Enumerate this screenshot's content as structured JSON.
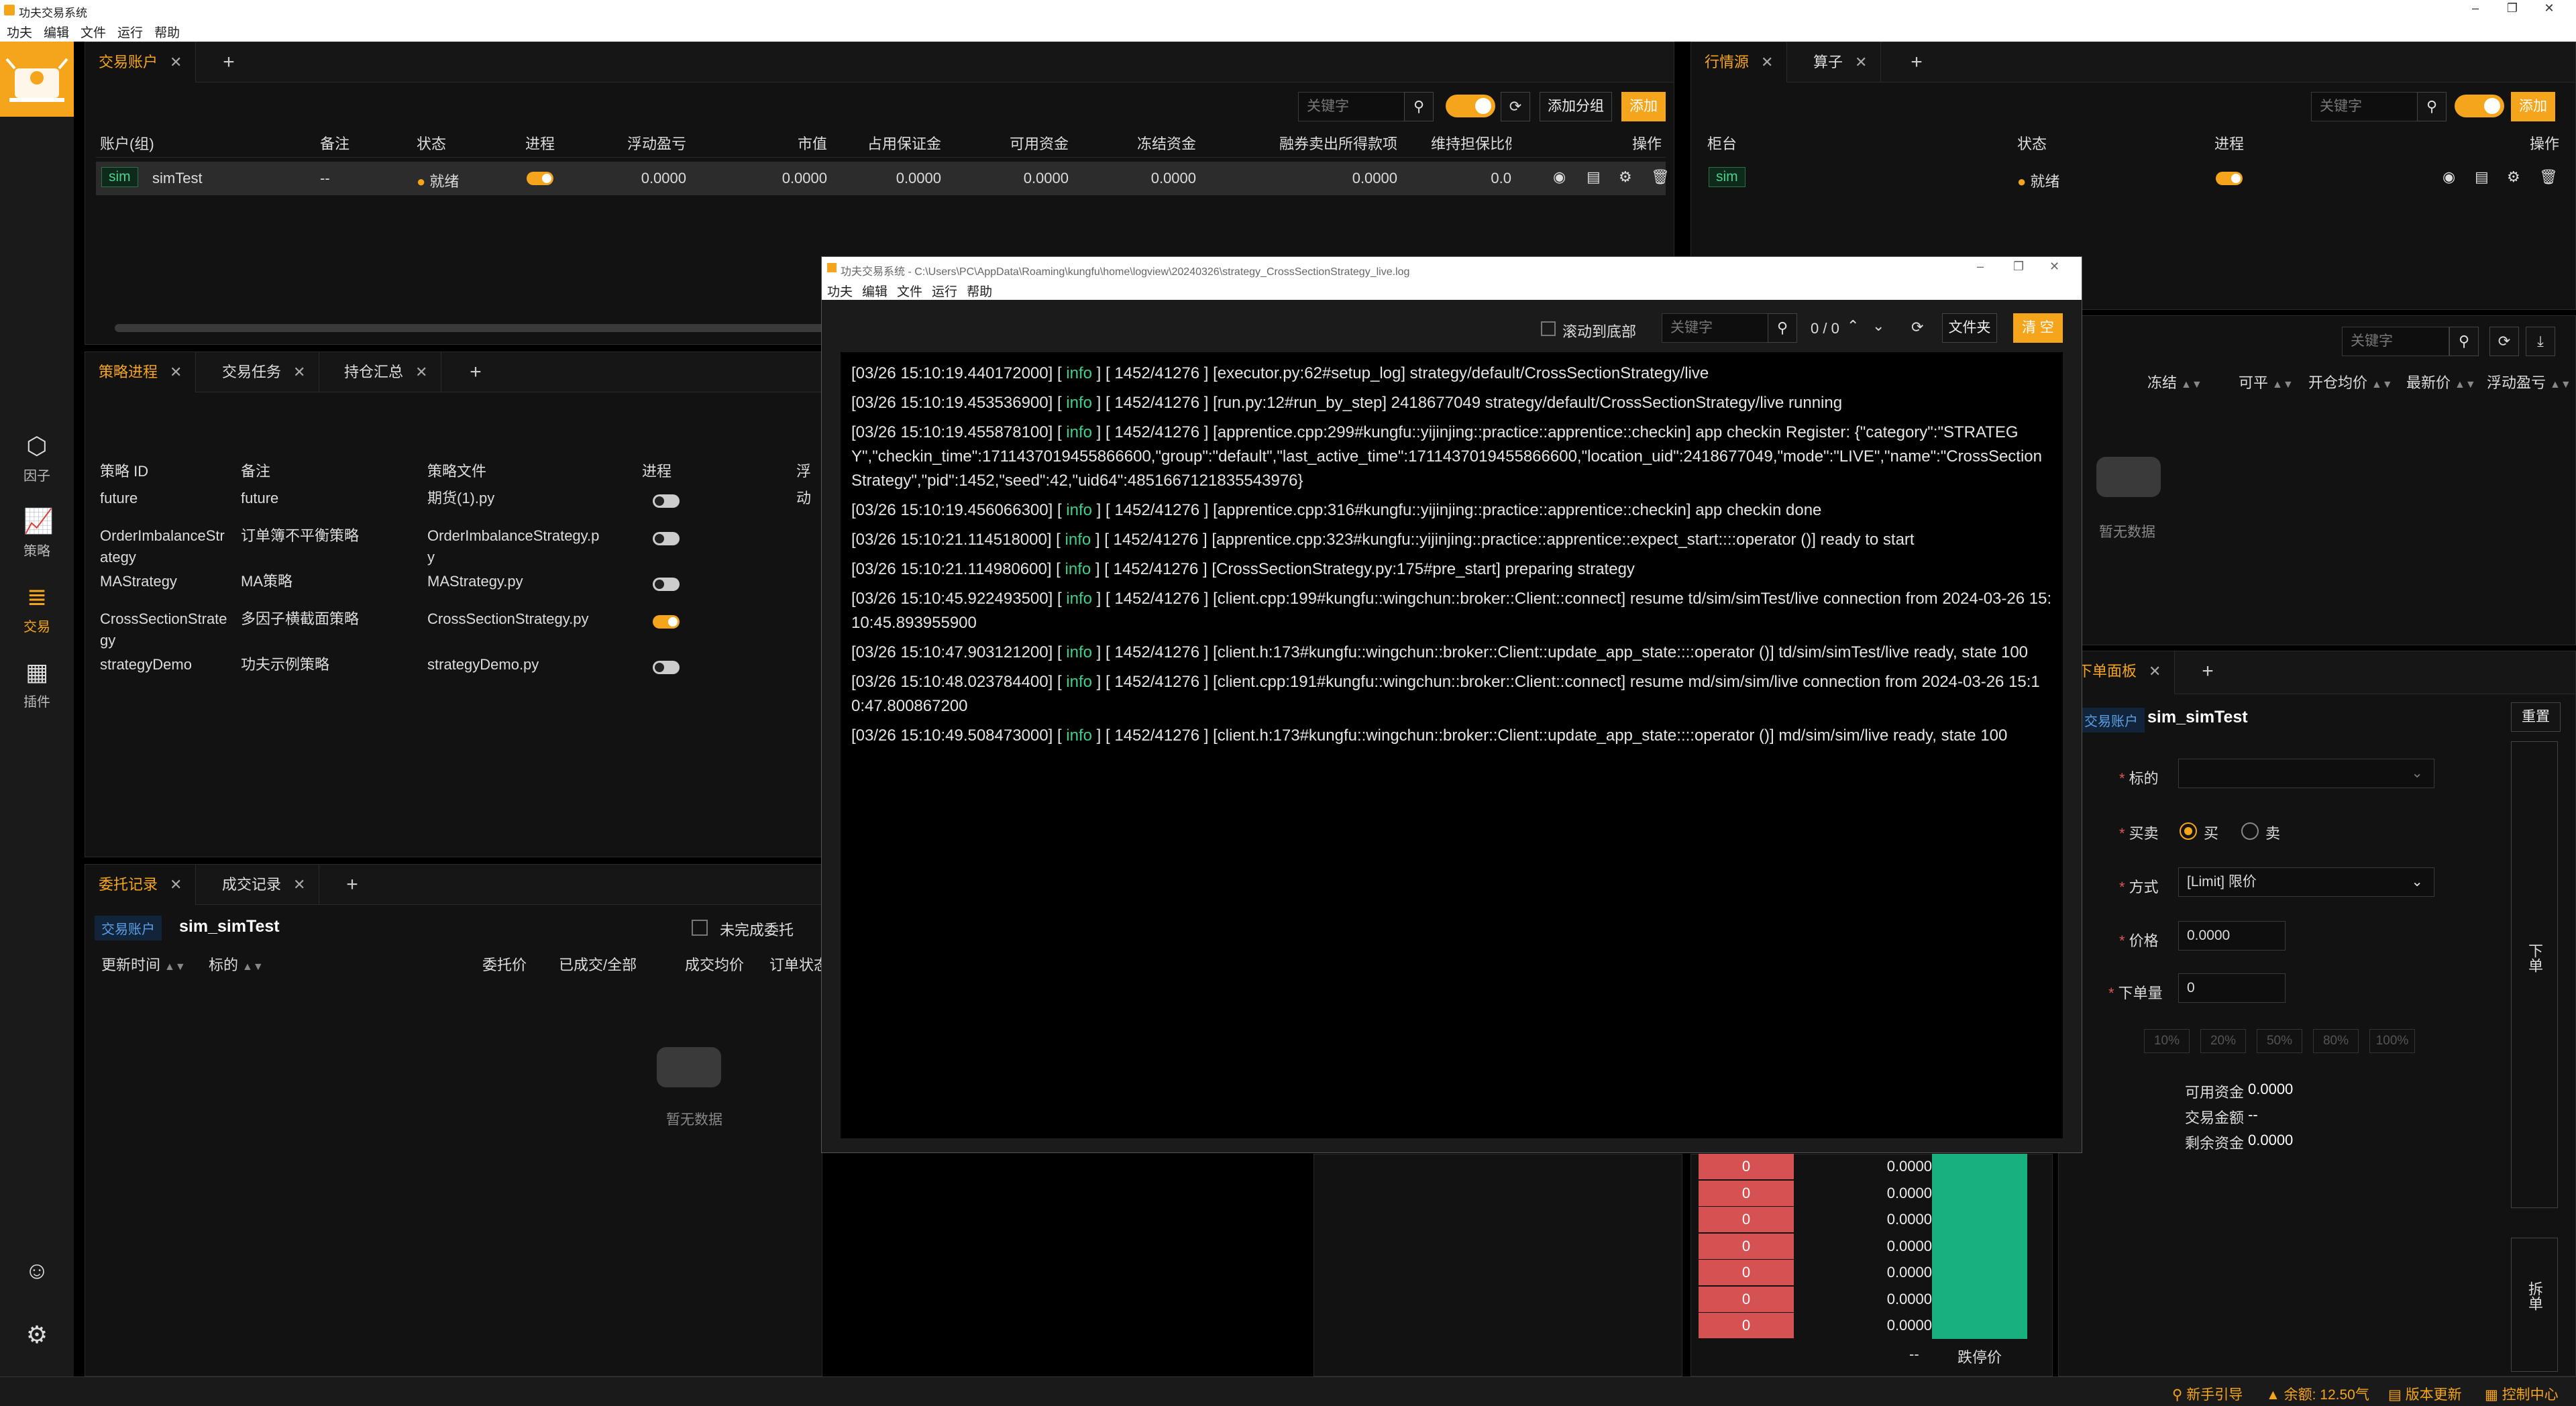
{
  "app": {
    "title": "功夫交易系统"
  },
  "menu": [
    "功夫",
    "编辑",
    "文件",
    "运行",
    "帮助"
  ],
  "sidebar": {
    "items": [
      {
        "label": "因子",
        "icon": "cube-icon"
      },
      {
        "label": "策略",
        "icon": "chart-line-icon"
      },
      {
        "label": "交易",
        "icon": "trade-icon",
        "active": true
      },
      {
        "label": "插件",
        "icon": "plugin-icon"
      }
    ]
  },
  "accounts": {
    "tab": "交易账户",
    "search_placeholder": "关键字",
    "add_group": "添加分组",
    "add": "添加",
    "columns": [
      "账户(组)",
      "备注",
      "状态",
      "进程",
      "浮动盈亏",
      "市值",
      "占用保证金",
      "可用资金",
      "冻结资金",
      "融券卖出所得款项",
      "维持担保比例",
      "操作"
    ],
    "rows": [
      {
        "tag": "sim",
        "name": "simTest",
        "note": "--",
        "status": "就绪",
        "floating": "0.0000",
        "market": "0.0000",
        "margin": "0.0000",
        "available": "0.0000",
        "frozen": "0.0000",
        "short_proceeds": "0.0000",
        "ratio": "0.0",
        "process_on": true
      }
    ]
  },
  "market": {
    "tabs": [
      "行情源",
      "算子"
    ],
    "search_placeholder": "关键字",
    "add": "添加",
    "columns": [
      "柜台",
      "状态",
      "进程",
      "操作"
    ],
    "rows": [
      {
        "tag": "sim",
        "status": "就绪",
        "process_on": true
      }
    ]
  },
  "positions": {
    "search_placeholder": "关键字",
    "columns": [
      "冻结",
      "可平",
      "开仓均价",
      "最新价",
      "浮动盈亏"
    ],
    "empty": "暂无数据"
  },
  "strategies": {
    "tabs": [
      "策略进程",
      "交易任务",
      "持仓汇总"
    ],
    "columns": [
      "策略 ID",
      "备注",
      "策略文件",
      "进程",
      "浮动"
    ],
    "rows": [
      {
        "id": "future",
        "note": "future",
        "file": "期货(1).py",
        "on": false
      },
      {
        "id": "OrderImbalanceStr\nategy",
        "note": "订单簿不平衡策略",
        "file": "OrderImbalanceStrategy.p\ny",
        "on": false
      },
      {
        "id": "MAStrategy",
        "note": "MA策略",
        "file": "MAStrategy.py",
        "on": false
      },
      {
        "id": "CrossSectionStrate\ngy",
        "note": "多因子横截面策略",
        "file": "CrossSectionStrategy.py",
        "on": true
      },
      {
        "id": "strategyDemo",
        "note": "功夫示例策略",
        "file": "strategyDemo.py",
        "on": false
      }
    ]
  },
  "orders": {
    "tabs": [
      "委托记录",
      "成交记录"
    ],
    "account_tag": "交易账户",
    "account_name": "sim_simTest",
    "unfinished": "未完成委托",
    "columns": [
      "更新时间",
      "标的",
      "委托价",
      "已成交/全部",
      "成交均价",
      "订单状态"
    ],
    "empty": "暂无数据"
  },
  "depth": {
    "bid_values": [
      "0",
      "0",
      "0",
      "0",
      "0",
      "0",
      "0"
    ],
    "prices": [
      "0.0000",
      "0.0000",
      "0.0000",
      "0.0000",
      "0.0000",
      "0.0000",
      "0.0000"
    ],
    "dash": "--",
    "limit_down": "跌停价"
  },
  "order_panel": {
    "tab": "下单面板",
    "account_tag": "交易账户",
    "account_name": "sim_simTest",
    "reset": "重置",
    "labels": {
      "instrument": "标的",
      "side": "买卖",
      "method": "方式",
      "price": "价格",
      "volume": "下单量"
    },
    "buy": "买",
    "sell": "卖",
    "method_value": "[Limit] 限价",
    "price_value": "0.0000",
    "volume_value": "0",
    "percents": [
      "10%",
      "20%",
      "50%",
      "80%",
      "100%"
    ],
    "available_label": "可用资金",
    "available_value": "0.0000",
    "amount_label": "交易金额",
    "amount_value": "--",
    "remain_label": "剩余资金",
    "remain_value": "0.0000",
    "submit": "下单",
    "split": "拆单"
  },
  "logwindow": {
    "title": "功夫交易系统 - C:\\Users\\PC\\AppData\\Roaming\\kungfu\\home\\logview\\20240326\\strategy_CrossSectionStrategy_live.log",
    "menu": [
      "功夫",
      "编辑",
      "文件",
      "运行",
      "帮助"
    ],
    "scroll_bottom": "滚动到底部",
    "search_placeholder": "关键字",
    "count": "0 / 0",
    "folder": "文件夹",
    "clear": "清 空",
    "lines": [
      {
        "pre": "[03/26 15:10:19.440172000] [ ",
        "lvl": "info",
        "post": " ] [ 1452/41276 ] [executor.py:62#setup_log] strategy/default/CrossSectionStrategy/live"
      },
      {
        "pre": "[03/26 15:10:19.453536900] [ ",
        "lvl": "info",
        "post": " ] [ 1452/41276 ] [run.py:12#run_by_step] 2418677049 strategy/default/CrossSectionStrategy/live running"
      },
      {
        "pre": "[03/26 15:10:19.455878100] [ ",
        "lvl": "info",
        "post": " ] [ 1452/41276 ] [apprentice.cpp:299#kungfu::yijinjing::practice::apprentice::checkin] app checkin Register: {\"category\":\"STRATEGY\",\"checkin_time\":1711437019455866600,\"group\":\"default\",\"last_active_time\":1711437019455866600,\"location_uid\":2418677049,\"mode\":\"LIVE\",\"name\":\"CrossSectionStrategy\",\"pid\":1452,\"seed\":42,\"uid64\":4851667121835543976}"
      },
      {
        "pre": "[03/26 15:10:19.456066300] [ ",
        "lvl": "info",
        "post": " ] [ 1452/41276 ] [apprentice.cpp:316#kungfu::yijinjing::practice::apprentice::checkin] app checkin done"
      },
      {
        "pre": "[03/26 15:10:21.114518000] [ ",
        "lvl": "info",
        "post": " ] [ 1452/41276 ] [apprentice.cpp:323#kungfu::yijinjing::practice::apprentice::expect_start::::operator ()] ready to start"
      },
      {
        "pre": "[03/26 15:10:21.114980600] [ ",
        "lvl": "info",
        "post": " ] [ 1452/41276 ] [CrossSectionStrategy.py:175#pre_start] preparing strategy"
      },
      {
        "pre": "[03/26 15:10:45.922493500] [ ",
        "lvl": "info",
        "post": " ] [ 1452/41276 ] [client.cpp:199#kungfu::wingchun::broker::Client::connect] resume td/sim/simTest/live connection from 2024-03-26 15:10:45.893955900"
      },
      {
        "pre": "[03/26 15:10:47.903121200] [ ",
        "lvl": "info",
        "post": " ] [ 1452/41276 ] [client.h:173#kungfu::wingchun::broker::Client::update_app_state::::operator ()] td/sim/simTest/live ready, state 100"
      },
      {
        "pre": "[03/26 15:10:48.023784400] [ ",
        "lvl": "info",
        "post": " ] [ 1452/41276 ] [client.cpp:191#kungfu::wingchun::broker::Client::connect] resume md/sim/sim/live connection from 2024-03-26 15:10:47.800867200"
      },
      {
        "pre": "[03/26 15:10:49.508473000] [ ",
        "lvl": "info",
        "post": " ] [ 1452/41276 ] [client.h:173#kungfu::wingchun::broker::Client::update_app_state::::operator ()] md/sim/sim/live ready, state 100"
      }
    ]
  },
  "statusbar": {
    "guide": "新手引导",
    "balance": "余额: 12.50气",
    "version": "版本更新",
    "control": "控制中心"
  },
  "colors": {
    "accent": "#f5a51c",
    "bg": "#000000",
    "panel": "#121212",
    "bid": "#d65252",
    "ask": "#19b07f",
    "info": "#3fd08a"
  }
}
